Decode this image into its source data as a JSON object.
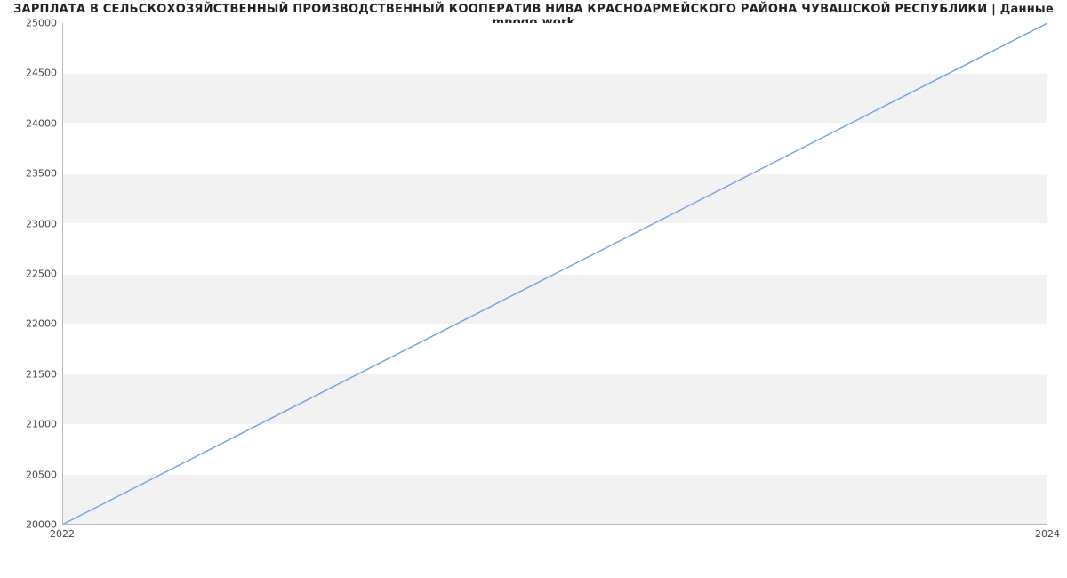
{
  "chart_data": {
    "type": "line",
    "title": "ЗАРПЛАТА В СЕЛЬСКОХОЗЯЙСТВЕННЫЙ ПРОИЗВОДСТВЕННЫЙ КООПЕРАТИВ НИВА КРАСНОАРМЕЙСКОГО РАЙОНА ЧУВАШСКОЙ РЕСПУБЛИКИ | Данные mnogo.work",
    "x": [
      2022,
      2024
    ],
    "values": [
      20000,
      25000
    ],
    "xlabel": "",
    "ylabel": "",
    "xlim": [
      2022,
      2024
    ],
    "ylim": [
      20000,
      25000
    ],
    "xticks": [
      2022,
      2024
    ],
    "yticks": [
      20000,
      20500,
      21000,
      21500,
      22000,
      22500,
      23000,
      23500,
      24000,
      24500,
      25000
    ],
    "line_color": "#6f9fe3",
    "grid": true
  }
}
